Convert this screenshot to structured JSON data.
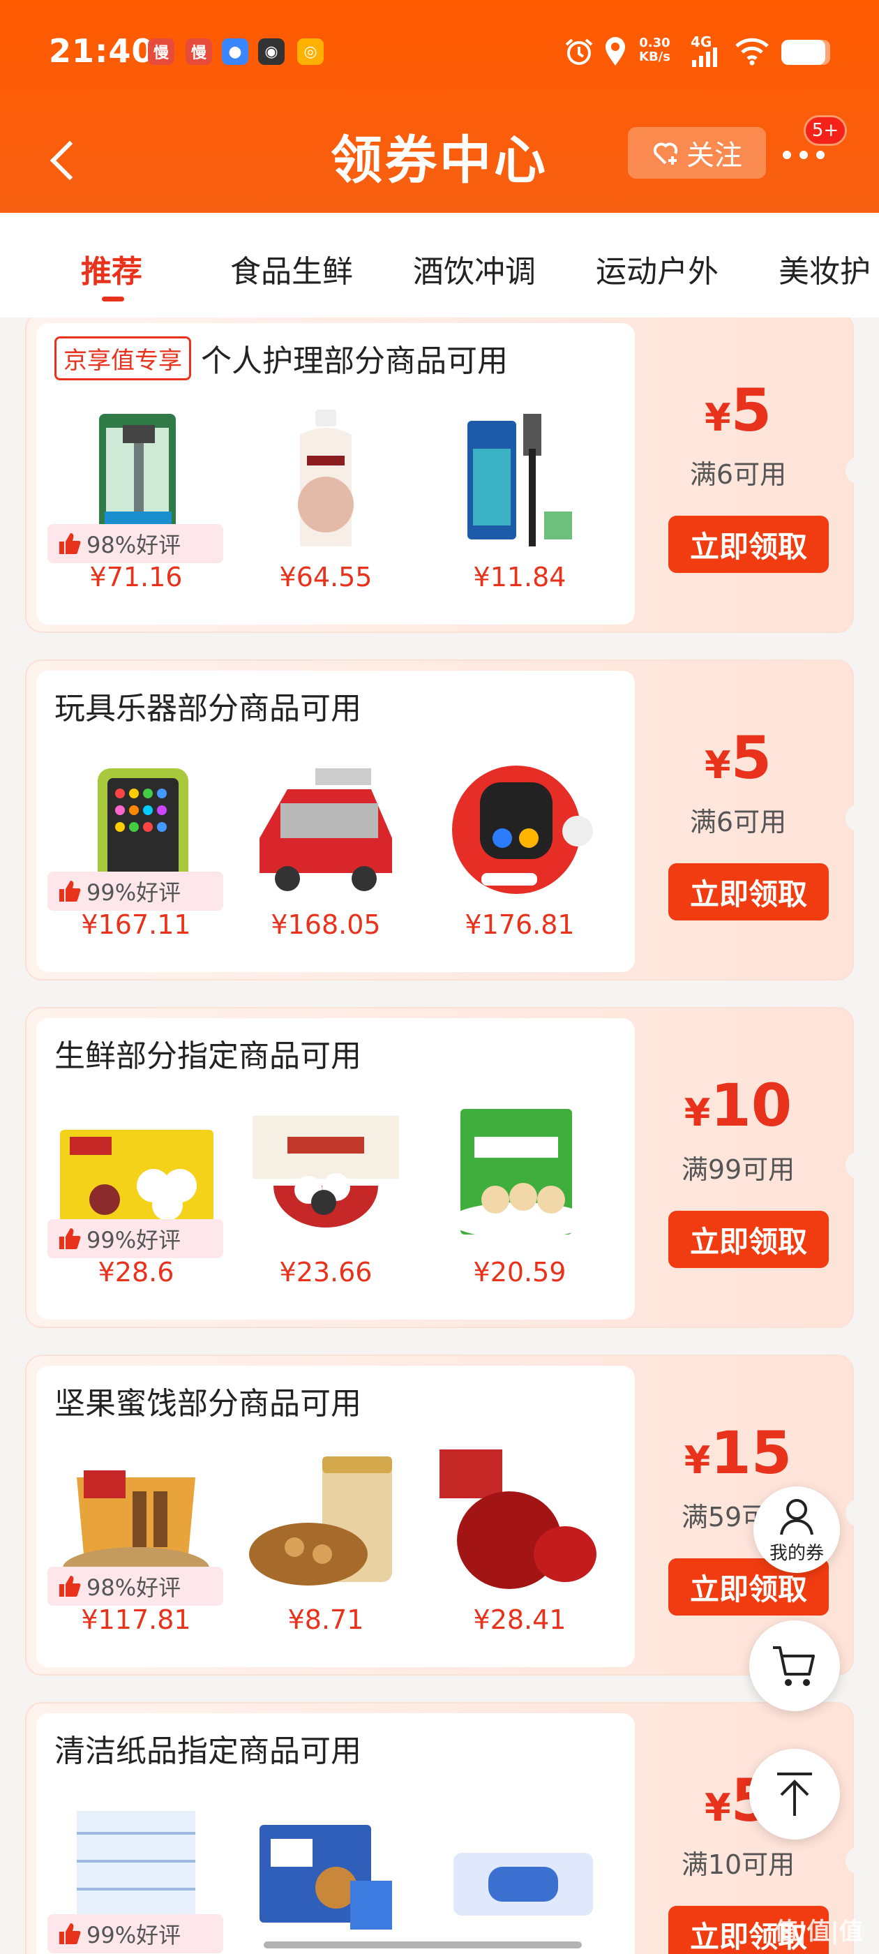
{
  "status_bar": {
    "time": "21:40",
    "app_icons": [
      "慢",
      "慢"
    ],
    "net_speed_value": "0.30",
    "net_speed_unit": "KB/s",
    "network": "4G",
    "battery_level": 0.9
  },
  "header": {
    "title": "领券中心",
    "follow_label": "关注",
    "more_badge": "5+",
    "bg_color": "#ff5a00"
  },
  "tabs": [
    "推荐",
    "食品生鲜",
    "酒饮冲调",
    "运动户外",
    "美妆护"
  ],
  "coupons": [
    {
      "tag": "京享值专享",
      "title": "个人护理部分商品可用",
      "good_rate": "98%好评",
      "currency": "¥",
      "amount": "5",
      "condition": "满6可用",
      "button": "立即领取",
      "products": [
        {
          "price": "¥71.16",
          "img": "razor-pack"
        },
        {
          "price": "¥64.55",
          "img": "body-wash-bottle"
        },
        {
          "price": "¥11.84",
          "img": "razor-pack"
        }
      ]
    },
    {
      "title": "玩具乐器部分商品可用",
      "good_rate": "99%好评",
      "currency": "¥",
      "amount": "5",
      "condition": "满6可用",
      "button": "立即领取",
      "products": [
        {
          "price": "¥167.11",
          "img": "drum-pad"
        },
        {
          "price": "¥168.05",
          "img": "toy-fire-truck"
        },
        {
          "price": "¥176.81",
          "img": "robot-speaker"
        }
      ]
    },
    {
      "title": "生鲜部分指定商品可用",
      "good_rate": "99%好评",
      "currency": "¥",
      "amount": "10",
      "condition": "满99可用",
      "button": "立即领取",
      "products": [
        {
          "price": "¥28.6",
          "img": "tangyuan-bag"
        },
        {
          "price": "¥23.66",
          "img": "tangyuan-bowl"
        },
        {
          "price": "¥20.59",
          "img": "shaomai-bag"
        }
      ]
    },
    {
      "title": "坚果蜜饯部分商品可用",
      "good_rate": "98%好评",
      "currency": "¥",
      "amount": "15",
      "condition": "满59可用",
      "button": "立即领取",
      "products": [
        {
          "price": "¥117.81",
          "img": "nut-gift-box"
        },
        {
          "price": "¥8.71",
          "img": "broad-beans-jar"
        },
        {
          "price": "¥28.41",
          "img": "red-dates"
        }
      ]
    },
    {
      "title": "清洁纸品指定商品可用",
      "good_rate": "99%好评",
      "currency": "¥",
      "amount": "5",
      "condition": "满10可用",
      "button": "立即领取",
      "products": [
        {
          "price": "",
          "img": "tissue-packs"
        },
        {
          "price": "",
          "img": "vinda-tissue-box"
        },
        {
          "price": "",
          "img": "wet-wipes"
        }
      ]
    }
  ],
  "floating": {
    "my_coupons": "我的券"
  },
  "watermark": "值|值|值"
}
